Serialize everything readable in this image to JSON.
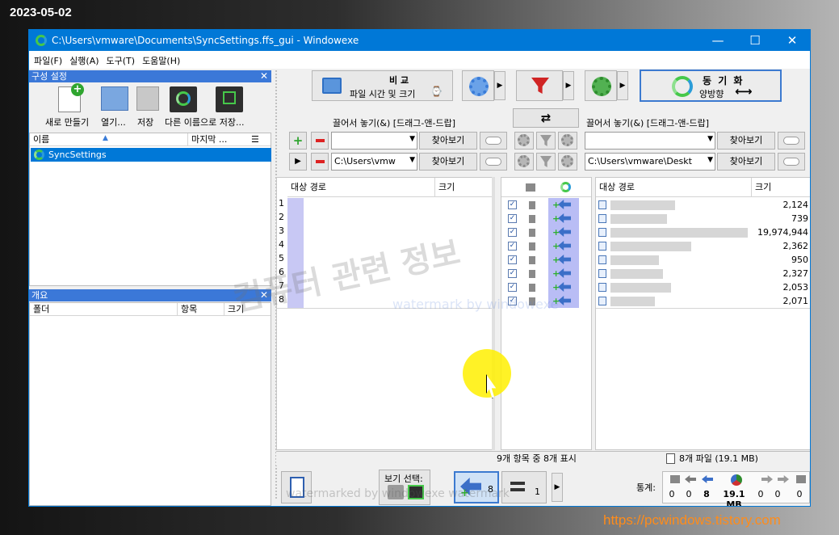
{
  "date": "2023-05-02",
  "site_url": "https://pcwindows.tistory.com",
  "window": {
    "title": "C:\\Users\\vmware\\Documents\\SyncSettings.ffs_gui  - Windowexe",
    "min": "—",
    "max": "☐",
    "close": "✕"
  },
  "menu": [
    "파일(F)",
    "실행(A)",
    "도구(T)",
    "도움말(H)"
  ],
  "config_panel": {
    "title": "구성 설정",
    "close": "✕",
    "buttons": [
      "새로 만들기",
      "열기...",
      "저장",
      "다른 이름으로 저장..."
    ],
    "col_name": "이름",
    "col_last": "마지막 ...",
    "items": [
      "SyncSettings"
    ]
  },
  "overview_panel": {
    "title": "개요",
    "close": "✕",
    "col_folder": "폴더",
    "col_items": "항목",
    "col_size": "크기"
  },
  "toolbar": {
    "compare_title": "비 교",
    "compare_sub": "파일 시간 및 크기",
    "sync_title": "동 기 화",
    "sync_sub": "양방향",
    "sync_arrow": "⟷"
  },
  "left_folder": {
    "drop_label": "끌어서 놓기(&) [드래그-앤-드랍]",
    "path": "C:\\Users\\vmw",
    "browse": "찾아보기"
  },
  "right_folder": {
    "drop_label": "끌어서 놓기(&) [드래그-앤-드랍]",
    "path": "C:\\Users\\vmware\\Deskt",
    "browse": "찾아보기"
  },
  "left_grid": {
    "col_path": "대상 경로",
    "col_size": "크기",
    "rows": [
      "1",
      "2",
      "3",
      "4",
      "5",
      "6",
      "7",
      "8"
    ]
  },
  "right_grid": {
    "col_path": "대상 경로",
    "col_size": "크기",
    "sizes": [
      "2,124",
      "739",
      "19,974,944",
      "2,362",
      "950",
      "2,327",
      "2,053",
      "2,071"
    ]
  },
  "status": {
    "center": "9개 항목 중 8개 표시",
    "right": "8개 파일 (19.1 MB)"
  },
  "bottom": {
    "view_select": "보기 선택:",
    "left_count": "8",
    "equal_count": "1",
    "stats_label": "통계:",
    "stats": [
      "0",
      "0",
      "8",
      "19.1 MB",
      "0",
      "0",
      "0"
    ]
  },
  "watermarks": {
    "korean": "컴퓨터 관련 정보",
    "en1": "watermark by windowexe",
    "en2": "watermarked by windowexe watermark"
  },
  "colors": {
    "titlebar": "#0078d7",
    "panel_header": "#3b78d8",
    "selection": "#0078d7",
    "action_bg": "#b9bdf5",
    "accent_orange": "#ff8c1a"
  }
}
